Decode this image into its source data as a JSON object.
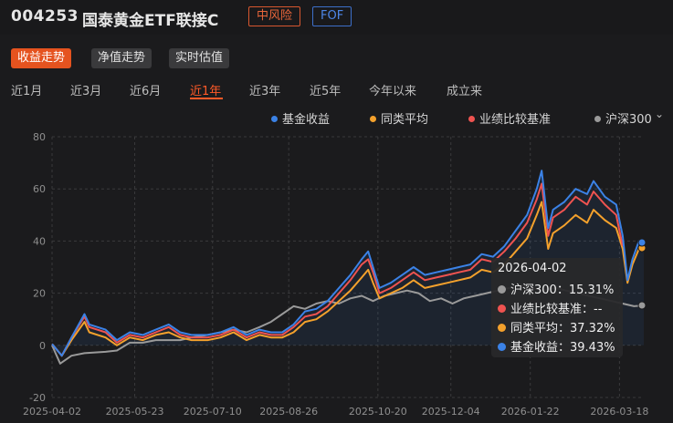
{
  "header": {
    "fund_code": "004253",
    "fund_name": "国泰黄金ETF联接C",
    "risk_badge": "中风险",
    "type_badge": "FOF"
  },
  "view_tabs": [
    {
      "label": "收益走势",
      "active": true
    },
    {
      "label": "净值走势",
      "active": false
    },
    {
      "label": "实时估值",
      "active": false
    }
  ],
  "range_tabs": [
    {
      "label": "近1月",
      "active": false
    },
    {
      "label": "近3月",
      "active": false
    },
    {
      "label": "近6月",
      "active": false
    },
    {
      "label": "近1年",
      "active": true
    },
    {
      "label": "近3年",
      "active": false
    },
    {
      "label": "近5年",
      "active": false
    },
    {
      "label": "今年以来",
      "active": false
    },
    {
      "label": "成立来",
      "active": false
    }
  ],
  "legend": [
    {
      "label": "基金收益",
      "color": "#3b82e6"
    },
    {
      "label": "同类平均",
      "color": "#f4a12c"
    },
    {
      "label": "业绩比较基准",
      "color": "#ef5350"
    },
    {
      "label": "沪深300",
      "color": "#9a9a9a"
    }
  ],
  "tooltip": {
    "date": "2026-04-02",
    "rows": [
      {
        "label": "沪深300：15.31%",
        "color": "#9a9a9a"
      },
      {
        "label": "业绩比较基准：--",
        "color": "#ef5350"
      },
      {
        "label": "同类平均：37.32%",
        "color": "#f4a12c"
      },
      {
        "label": "基金收益：39.43%",
        "color": "#3b82e6"
      }
    ]
  },
  "chart_data": {
    "type": "line",
    "x_ticks": [
      "2025-04-02",
      "2025-05-23",
      "2025-07-10",
      "2025-08-26",
      "2025-10-20",
      "2025-12-04",
      "2026-01-22",
      "2026-03-18"
    ],
    "y_ticks": [
      80,
      60,
      40,
      20,
      0,
      -20
    ],
    "ylim": [
      -20,
      80
    ],
    "x_range": [
      "2025-04-02",
      "2026-04-02"
    ],
    "grid": true,
    "series": [
      {
        "name": "基金收益",
        "color": "#3b82e6",
        "points": [
          [
            "2025-04-02",
            0.5
          ],
          [
            "2025-04-08",
            -4
          ],
          [
            "2025-04-14",
            3
          ],
          [
            "2025-04-22",
            12
          ],
          [
            "2025-04-25",
            8
          ],
          [
            "2025-05-05",
            6
          ],
          [
            "2025-05-12",
            2
          ],
          [
            "2025-05-20",
            5
          ],
          [
            "2025-05-28",
            4
          ],
          [
            "2025-06-05",
            6
          ],
          [
            "2025-06-13",
            8
          ],
          [
            "2025-06-20",
            5
          ],
          [
            "2025-06-27",
            4
          ],
          [
            "2025-07-07",
            4
          ],
          [
            "2025-07-15",
            5
          ],
          [
            "2025-07-23",
            7
          ],
          [
            "2025-07-31",
            4
          ],
          [
            "2025-08-08",
            6
          ],
          [
            "2025-08-15",
            5
          ],
          [
            "2025-08-22",
            5
          ],
          [
            "2025-08-29",
            8
          ],
          [
            "2025-09-05",
            13
          ],
          [
            "2025-09-12",
            14
          ],
          [
            "2025-09-19",
            17
          ],
          [
            "2025-09-26",
            22
          ],
          [
            "2025-10-03",
            27
          ],
          [
            "2025-10-10",
            33
          ],
          [
            "2025-10-14",
            36
          ],
          [
            "2025-10-17",
            30
          ],
          [
            "2025-10-21",
            22
          ],
          [
            "2025-10-28",
            24
          ],
          [
            "2025-11-04",
            27
          ],
          [
            "2025-11-11",
            30
          ],
          [
            "2025-11-18",
            27
          ],
          [
            "2025-11-25",
            28
          ],
          [
            "2025-12-02",
            29
          ],
          [
            "2025-12-09",
            30
          ],
          [
            "2025-12-16",
            31
          ],
          [
            "2025-12-23",
            35
          ],
          [
            "2025-12-30",
            34
          ],
          [
            "2026-01-06",
            38
          ],
          [
            "2026-01-13",
            44
          ],
          [
            "2026-01-20",
            50
          ],
          [
            "2026-01-26",
            60
          ],
          [
            "2026-01-29",
            67
          ],
          [
            "2026-02-02",
            45
          ],
          [
            "2026-02-05",
            52
          ],
          [
            "2026-02-12",
            55
          ],
          [
            "2026-02-19",
            60
          ],
          [
            "2026-02-26",
            58
          ],
          [
            "2026-03-02",
            63
          ],
          [
            "2026-03-09",
            57
          ],
          [
            "2026-03-16",
            54
          ],
          [
            "2026-03-20",
            42
          ],
          [
            "2026-03-23",
            25
          ],
          [
            "2026-03-26",
            33
          ],
          [
            "2026-03-30",
            40
          ],
          [
            "2026-04-02",
            39.43
          ]
        ]
      },
      {
        "name": "业绩比较基准",
        "color": "#ef5350",
        "points": [
          [
            "2025-04-02",
            0.5
          ],
          [
            "2025-04-08",
            -4
          ],
          [
            "2025-04-14",
            3
          ],
          [
            "2025-04-22",
            11
          ],
          [
            "2025-04-25",
            7
          ],
          [
            "2025-05-05",
            5
          ],
          [
            "2025-05-12",
            1
          ],
          [
            "2025-05-20",
            4
          ],
          [
            "2025-05-28",
            3
          ],
          [
            "2025-06-05",
            5
          ],
          [
            "2025-06-13",
            7
          ],
          [
            "2025-06-20",
            4
          ],
          [
            "2025-06-27",
            3
          ],
          [
            "2025-07-07",
            3
          ],
          [
            "2025-07-15",
            4
          ],
          [
            "2025-07-23",
            6
          ],
          [
            "2025-07-31",
            3
          ],
          [
            "2025-08-08",
            5
          ],
          [
            "2025-08-15",
            4
          ],
          [
            "2025-08-22",
            4
          ],
          [
            "2025-08-29",
            7
          ],
          [
            "2025-09-05",
            11
          ],
          [
            "2025-09-12",
            12
          ],
          [
            "2025-09-19",
            15
          ],
          [
            "2025-09-26",
            20
          ],
          [
            "2025-10-03",
            25
          ],
          [
            "2025-10-10",
            31
          ],
          [
            "2025-10-14",
            33
          ],
          [
            "2025-10-17",
            28
          ],
          [
            "2025-10-21",
            20
          ],
          [
            "2025-10-28",
            22
          ],
          [
            "2025-11-04",
            25
          ],
          [
            "2025-11-11",
            28
          ],
          [
            "2025-11-18",
            25
          ],
          [
            "2025-11-25",
            26
          ],
          [
            "2025-12-02",
            27
          ],
          [
            "2025-12-09",
            28
          ],
          [
            "2025-12-16",
            29
          ],
          [
            "2025-12-23",
            33
          ],
          [
            "2025-12-30",
            32
          ],
          [
            "2026-01-06",
            36
          ],
          [
            "2026-01-13",
            41
          ],
          [
            "2026-01-20",
            47
          ],
          [
            "2026-01-26",
            56
          ],
          [
            "2026-01-29",
            62
          ],
          [
            "2026-02-02",
            42
          ],
          [
            "2026-02-05",
            49
          ],
          [
            "2026-02-12",
            52
          ],
          [
            "2026-02-19",
            57
          ],
          [
            "2026-02-26",
            54
          ],
          [
            "2026-03-02",
            59
          ],
          [
            "2026-03-09",
            54
          ],
          [
            "2026-03-16",
            50
          ],
          [
            "2026-03-20",
            38
          ]
        ]
      },
      {
        "name": "同类平均",
        "color": "#f4a12c",
        "points": [
          [
            "2025-04-02",
            0.5
          ],
          [
            "2025-04-08",
            -4
          ],
          [
            "2025-04-14",
            2
          ],
          [
            "2025-04-22",
            9
          ],
          [
            "2025-04-25",
            5
          ],
          [
            "2025-05-05",
            3
          ],
          [
            "2025-05-12",
            0
          ],
          [
            "2025-05-20",
            3
          ],
          [
            "2025-05-28",
            2
          ],
          [
            "2025-06-05",
            4
          ],
          [
            "2025-06-13",
            5
          ],
          [
            "2025-06-20",
            3
          ],
          [
            "2025-06-27",
            2
          ],
          [
            "2025-07-07",
            2
          ],
          [
            "2025-07-15",
            3
          ],
          [
            "2025-07-23",
            5
          ],
          [
            "2025-07-31",
            2
          ],
          [
            "2025-08-08",
            4
          ],
          [
            "2025-08-15",
            3
          ],
          [
            "2025-08-22",
            3
          ],
          [
            "2025-08-29",
            5
          ],
          [
            "2025-09-05",
            9
          ],
          [
            "2025-09-12",
            10
          ],
          [
            "2025-09-19",
            13
          ],
          [
            "2025-09-26",
            17
          ],
          [
            "2025-10-03",
            21
          ],
          [
            "2025-10-10",
            26
          ],
          [
            "2025-10-14",
            29
          ],
          [
            "2025-10-17",
            24
          ],
          [
            "2025-10-21",
            18
          ],
          [
            "2025-10-28",
            20
          ],
          [
            "2025-11-04",
            22
          ],
          [
            "2025-11-11",
            25
          ],
          [
            "2025-11-18",
            22
          ],
          [
            "2025-11-25",
            23
          ],
          [
            "2025-12-02",
            24
          ],
          [
            "2025-12-09",
            25
          ],
          [
            "2025-12-16",
            26
          ],
          [
            "2025-12-23",
            29
          ],
          [
            "2025-12-30",
            28
          ],
          [
            "2026-01-06",
            31
          ],
          [
            "2026-01-13",
            36
          ],
          [
            "2026-01-20",
            41
          ],
          [
            "2026-01-26",
            50
          ],
          [
            "2026-01-29",
            55
          ],
          [
            "2026-02-02",
            37
          ],
          [
            "2026-02-05",
            43
          ],
          [
            "2026-02-12",
            46
          ],
          [
            "2026-02-19",
            50
          ],
          [
            "2026-02-26",
            47
          ],
          [
            "2026-03-02",
            52
          ],
          [
            "2026-03-09",
            48
          ],
          [
            "2026-03-16",
            45
          ],
          [
            "2026-03-20",
            37
          ],
          [
            "2026-03-23",
            24
          ],
          [
            "2026-03-26",
            31
          ],
          [
            "2026-03-30",
            37
          ],
          [
            "2026-04-02",
            37.32
          ]
        ]
      },
      {
        "name": "沪深300",
        "color": "#9a9a9a",
        "points": [
          [
            "2025-04-02",
            0
          ],
          [
            "2025-04-07",
            -7
          ],
          [
            "2025-04-14",
            -4
          ],
          [
            "2025-04-22",
            -3
          ],
          [
            "2025-05-05",
            -2.5
          ],
          [
            "2025-05-12",
            -2
          ],
          [
            "2025-05-20",
            1
          ],
          [
            "2025-05-28",
            1
          ],
          [
            "2025-06-05",
            2
          ],
          [
            "2025-06-13",
            2
          ],
          [
            "2025-06-20",
            2
          ],
          [
            "2025-06-27",
            3
          ],
          [
            "2025-07-07",
            4
          ],
          [
            "2025-07-15",
            5
          ],
          [
            "2025-07-23",
            6
          ],
          [
            "2025-07-31",
            5
          ],
          [
            "2025-08-08",
            7
          ],
          [
            "2025-08-15",
            9
          ],
          [
            "2025-08-22",
            12
          ],
          [
            "2025-08-29",
            15
          ],
          [
            "2025-09-05",
            14
          ],
          [
            "2025-09-12",
            16
          ],
          [
            "2025-09-19",
            17
          ],
          [
            "2025-09-26",
            16
          ],
          [
            "2025-10-03",
            18
          ],
          [
            "2025-10-10",
            19
          ],
          [
            "2025-10-17",
            17
          ],
          [
            "2025-10-24",
            19
          ],
          [
            "2025-10-31",
            20
          ],
          [
            "2025-11-07",
            21
          ],
          [
            "2025-11-14",
            20
          ],
          [
            "2025-11-21",
            17
          ],
          [
            "2025-11-28",
            18
          ],
          [
            "2025-12-05",
            16
          ],
          [
            "2025-12-12",
            18
          ],
          [
            "2025-12-19",
            19
          ],
          [
            "2025-12-26",
            20
          ],
          [
            "2026-01-02",
            21
          ],
          [
            "2026-01-09",
            22
          ],
          [
            "2026-01-16",
            23
          ],
          [
            "2026-01-23",
            22
          ],
          [
            "2026-01-30",
            21
          ],
          [
            "2026-02-06",
            22
          ],
          [
            "2026-02-13",
            21
          ],
          [
            "2026-02-20",
            20
          ],
          [
            "2026-02-27",
            19
          ],
          [
            "2026-03-06",
            18
          ],
          [
            "2026-03-13",
            17
          ],
          [
            "2026-03-20",
            16
          ],
          [
            "2026-03-27",
            15
          ],
          [
            "2026-04-02",
            15.31
          ]
        ]
      }
    ]
  }
}
